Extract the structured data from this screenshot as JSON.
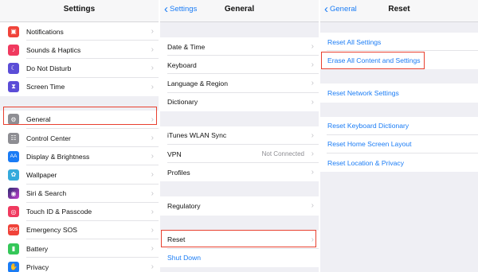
{
  "settings": {
    "title": "Settings",
    "group1": [
      {
        "label": "Notifications",
        "icon": "notifications-icon",
        "color": "#f0433a",
        "glyph": "▣"
      },
      {
        "label": "Sounds & Haptics",
        "icon": "speaker-icon",
        "color": "#f03a5f",
        "glyph": "♪"
      },
      {
        "label": "Do Not Disturb",
        "icon": "moon-icon",
        "color": "#5b4dd7",
        "glyph": "☾"
      },
      {
        "label": "Screen Time",
        "icon": "hourglass-icon",
        "color": "#5b4dd7",
        "glyph": "⧗"
      }
    ],
    "group2": [
      {
        "label": "General",
        "icon": "gear-icon",
        "color": "#8e8e93",
        "glyph": "⚙"
      },
      {
        "label": "Control Center",
        "icon": "toggles-icon",
        "color": "#8e8e93",
        "glyph": "☷"
      },
      {
        "label": "Display & Brightness",
        "icon": "text-size-icon",
        "color": "#1a7cf5",
        "glyph": "AA"
      },
      {
        "label": "Wallpaper",
        "icon": "flower-icon",
        "color": "#34aadc",
        "glyph": "✿"
      },
      {
        "label": "Siri & Search",
        "icon": "siri-icon",
        "color": "#222222",
        "glyph": "◉"
      },
      {
        "label": "Touch ID & Passcode",
        "icon": "fingerprint-icon",
        "color": "#f03a5f",
        "glyph": "◎"
      },
      {
        "label": "Emergency SOS",
        "icon": "sos-icon",
        "color": "#f0433a",
        "glyph": "SOS"
      },
      {
        "label": "Battery",
        "icon": "battery-icon",
        "color": "#35c759",
        "glyph": "▮"
      },
      {
        "label": "Privacy",
        "icon": "hand-icon",
        "color": "#1a7cf5",
        "glyph": "✋"
      }
    ]
  },
  "general": {
    "back": "Settings",
    "title": "General",
    "group1": [
      {
        "label": "Date & Time"
      },
      {
        "label": "Keyboard"
      },
      {
        "label": "Language & Region"
      },
      {
        "label": "Dictionary"
      }
    ],
    "group2": [
      {
        "label": "iTunes WLAN Sync"
      },
      {
        "label": "VPN",
        "value": "Not Connected"
      },
      {
        "label": "Profiles"
      }
    ],
    "group3": [
      {
        "label": "Regulatory"
      }
    ],
    "group4": [
      {
        "label": "Reset"
      }
    ],
    "shutdown": "Shut Down"
  },
  "reset": {
    "back": "General",
    "title": "Reset",
    "group1": [
      "Reset All Settings",
      "Erase All Content and Settings"
    ],
    "group2": [
      "Reset Network Settings"
    ],
    "group3": [
      "Reset Keyboard Dictionary",
      "Reset Home Screen Layout",
      "Reset Location & Privacy"
    ]
  },
  "colors": {
    "accent": "#1a7cf5",
    "highlight": "#e8402f",
    "background": "#efeff4"
  },
  "chevron": "›",
  "back_chevron": "‹"
}
